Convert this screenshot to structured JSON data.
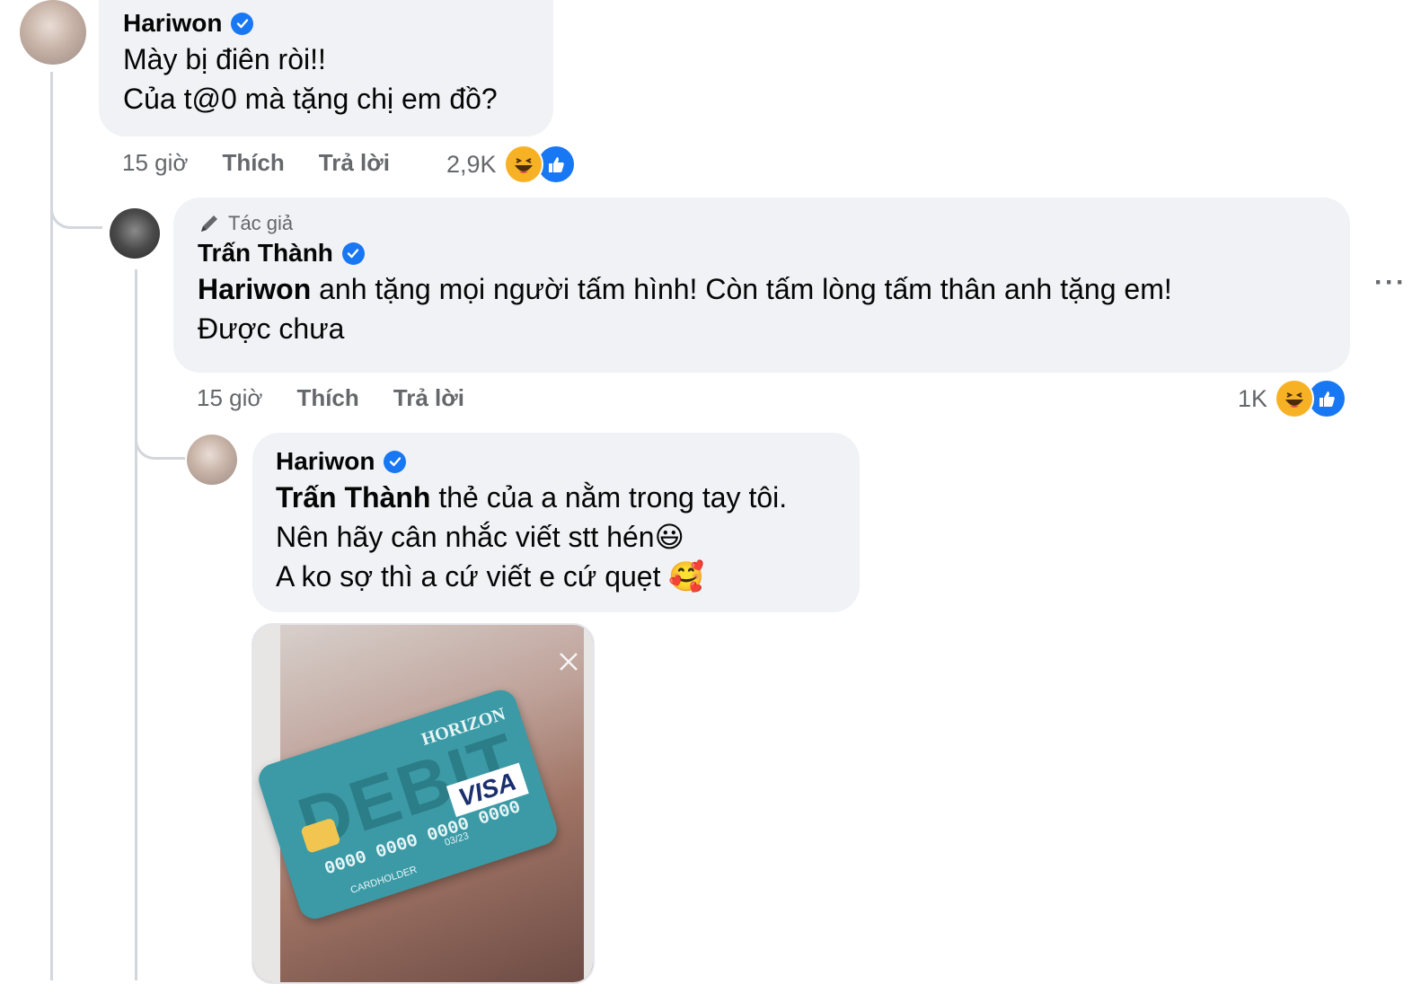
{
  "comments": [
    {
      "author": "Hariwon",
      "lines": [
        "Mày bị điên ròi!!",
        "Của t@0 mà tặng chị em đồ?"
      ],
      "time": "15 giờ",
      "like_label": "Thích",
      "reply_label": "Trả lời",
      "reaction_count": "2,9K"
    },
    {
      "badge": "Tác giả",
      "author": "Trấn Thành",
      "mention": "Hariwon",
      "line1_rest": " anh tặng mọi người tấm hình! Còn tấm lòng tấm thân anh tặng em!",
      "line2": "Được chưa",
      "time": "15 giờ",
      "like_label": "Thích",
      "reply_label": "Trả lời",
      "reaction_count": "1K",
      "more": "···"
    },
    {
      "author": "Hariwon",
      "mention": "Trấn Thành",
      "line1_rest": " thẻ của a nằm trong tay tôi.",
      "line2": "Nên hãy cân nhắc viết stt hén😃",
      "line3": "A ko sợ thì a cứ viết e cứ quẹt 🥰"
    }
  ],
  "photo": {
    "card_word": "DEBIT",
    "card_bank": "HORIZON",
    "card_number": "0000 0000 0000 0000",
    "card_brand": "VISA",
    "card_holder": "CARDHOLDER",
    "card_expiry": "03/23"
  },
  "icons": [
    "verified-badge-icon",
    "pencil-icon",
    "haha-reaction-icon",
    "like-reaction-icon",
    "more-options-icon",
    "close-icon"
  ],
  "colors": {
    "bubble": "#f0f2f5",
    "verified": "#1877f2",
    "meta_text": "#65676b"
  }
}
